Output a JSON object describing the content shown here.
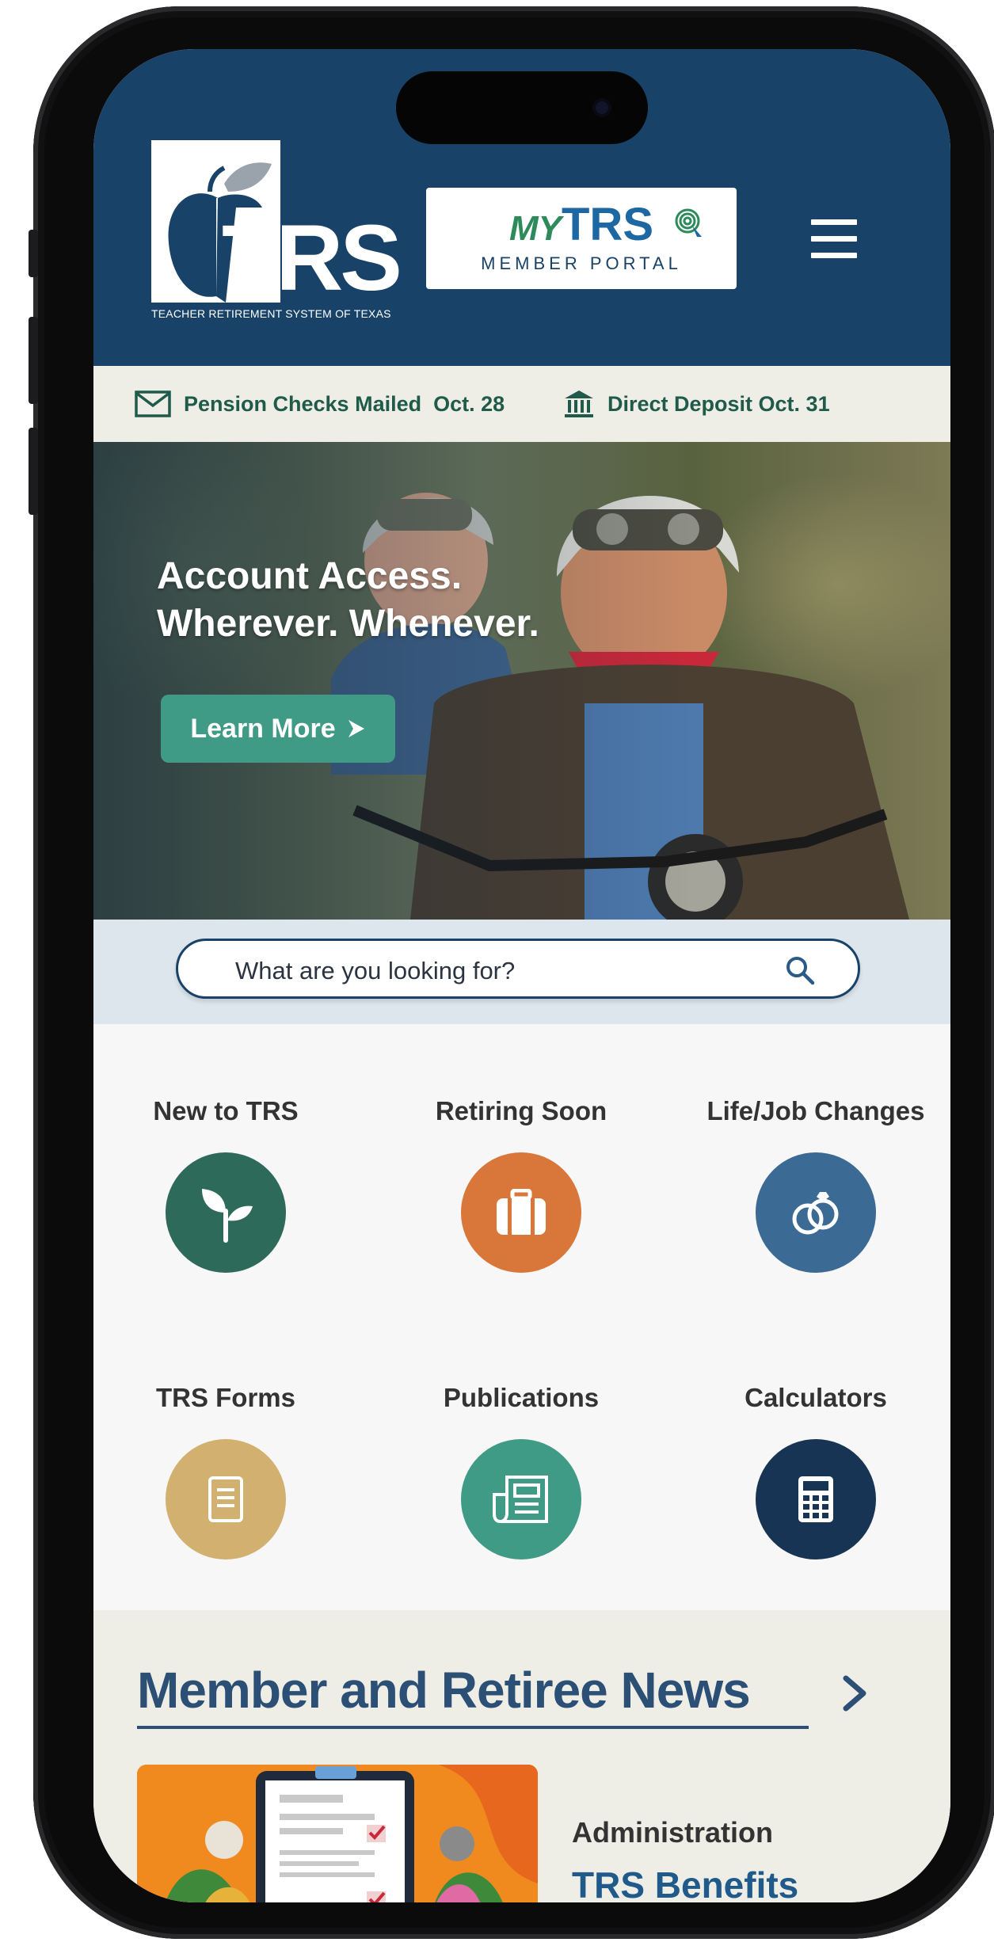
{
  "header": {
    "logo_letters": "TRS",
    "logo_tagline": "TEACHER RETIREMENT SYSTEM OF TEXAS",
    "portal_brand_my": "MY",
    "portal_brand_trs": "TRS",
    "portal_subtitle": "MEMBER PORTAL",
    "menu_icon": "hamburger-icon"
  },
  "notices": [
    {
      "icon": "mail-icon",
      "text": "Pension Checks Mailed  Oct. 28"
    },
    {
      "icon": "bank-icon",
      "text": "Direct Deposit Oct. 31"
    }
  ],
  "hero": {
    "line1": "Account Access.",
    "line2": "Wherever. Whenever.",
    "button_label": "Learn More"
  },
  "search": {
    "placeholder": "What are you looking for?",
    "icon": "search-icon"
  },
  "quick_links": [
    {
      "label": "New to TRS",
      "icon": "sprout-icon",
      "color": "#2e6a5a"
    },
    {
      "label": "Retiring Soon",
      "icon": "suitcase-icon",
      "color": "#d9773a"
    },
    {
      "label": "Life/Job Changes",
      "icon": "rings-icon",
      "color": "#3b6a94"
    },
    {
      "label": "TRS Forms",
      "icon": "document-icon",
      "color": "#d1b070"
    },
    {
      "label": "Publications",
      "icon": "newspaper-icon",
      "color": "#3f9b86"
    },
    {
      "label": "Calculators",
      "icon": "calculator-icon",
      "color": "#183454"
    }
  ],
  "news": {
    "title": "Member and Retiree News",
    "category": "Administration",
    "headline": "TRS Benefits"
  },
  "colors": {
    "header_bg": "#184268",
    "accent_green": "#3f9b86",
    "notice_text": "#1f5a4a",
    "news_title": "#2b4f75"
  }
}
